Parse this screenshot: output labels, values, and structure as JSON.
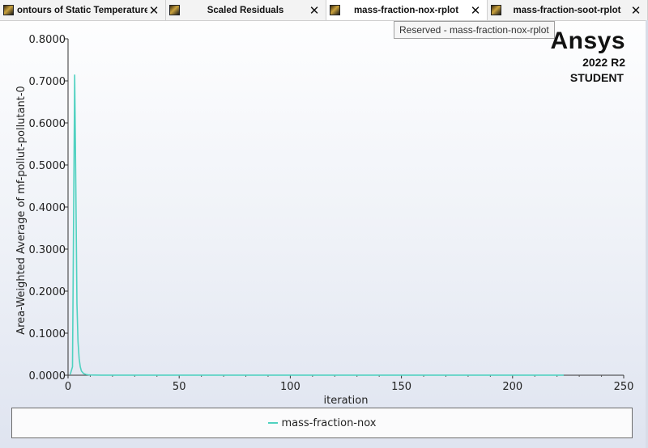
{
  "tabs": [
    {
      "label": "ontours of Static Temperature [K",
      "active": false
    },
    {
      "label": "Scaled Residuals",
      "active": false
    },
    {
      "label": "mass-fraction-nox-rplot",
      "active": true
    },
    {
      "label": "mass-fraction-soot-rplot",
      "active": false
    }
  ],
  "tab_close_glyph": "✕",
  "tooltip": "Reserved - mass-fraction-nox-rplot",
  "brand": {
    "logo": "Ansys",
    "version": "2022 R2",
    "edition": "STUDENT"
  },
  "chart_data": {
    "type": "line",
    "xlabel": "iteration",
    "ylabel": "Area-Weighted Average of mf-pollut-pollutant-0",
    "xlim": [
      0,
      250
    ],
    "ylim": [
      0,
      0.8
    ],
    "x_ticks": [
      "0",
      "50",
      "100",
      "150",
      "200",
      "250"
    ],
    "y_ticks": [
      "0.0000",
      "0.1000",
      "0.2000",
      "0.3000",
      "0.4000",
      "0.5000",
      "0.6000",
      "0.7000",
      "0.8000"
    ],
    "grid": false,
    "legend_position": "bottom",
    "series": [
      {
        "name": "mass-fraction-nox",
        "color": "#4fd1c0",
        "x": [
          1,
          2,
          3,
          3.5,
          4,
          4.5,
          5,
          5.5,
          6,
          7,
          8,
          9,
          10,
          12,
          15,
          20,
          50,
          100,
          150,
          200,
          223
        ],
        "y": [
          0.002,
          0.02,
          0.715,
          0.45,
          0.17,
          0.08,
          0.04,
          0.02,
          0.01,
          0.004,
          0.002,
          0.001,
          0.0005,
          0.0003,
          0.0002,
          0.0001,
          0.0001,
          0.0001,
          0.0001,
          0.0001,
          0.0001
        ]
      }
    ]
  }
}
